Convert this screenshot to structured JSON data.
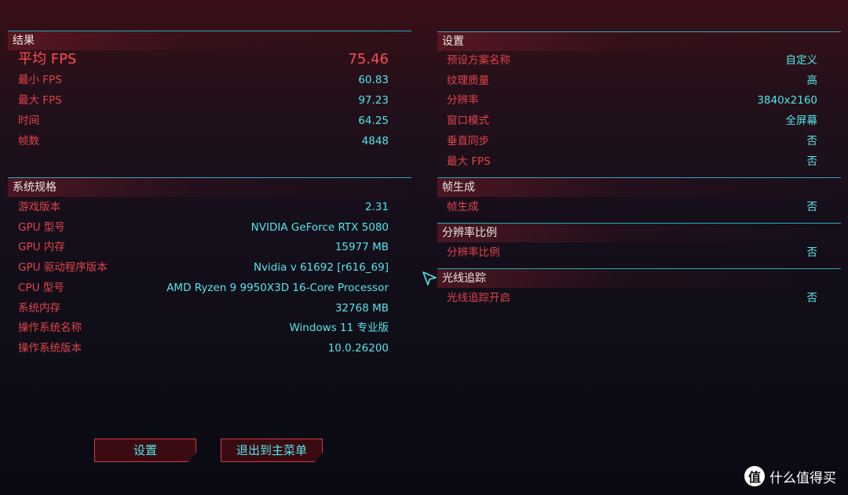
{
  "results": {
    "title": "结果",
    "avg": {
      "label": "平均 FPS",
      "value": "75.46"
    },
    "rows": [
      {
        "label": "最小 FPS",
        "value": "60.83"
      },
      {
        "label": "最大 FPS",
        "value": "97.23"
      },
      {
        "label": "时间",
        "value": "64.25"
      },
      {
        "label": "帧数",
        "value": "4848"
      }
    ]
  },
  "system": {
    "title": "系统规格",
    "rows": [
      {
        "label": "游戏版本",
        "value": "2.31"
      },
      {
        "label": "GPU 型号",
        "value": "NVIDIA GeForce RTX 5080"
      },
      {
        "label": "GPU 内存",
        "value": "15977 MB"
      },
      {
        "label": "GPU 驱动程序版本",
        "value": "Nvidia v 61692 [r616_69]"
      },
      {
        "label": "CPU 型号",
        "value": "AMD Ryzen 9 9950X3D 16-Core Processor"
      },
      {
        "label": "系统内存",
        "value": "32768 MB"
      },
      {
        "label": "操作系统名称",
        "value": "Windows 11 专业版"
      },
      {
        "label": "操作系统版本",
        "value": "10.0.26200"
      }
    ]
  },
  "settings": {
    "title": "设置",
    "rows": [
      {
        "label": "预设方案名称",
        "value": "自定义"
      },
      {
        "label": "纹理质量",
        "value": "高"
      },
      {
        "label": "分辨率",
        "value": "3840x2160"
      },
      {
        "label": "窗口模式",
        "value": "全屏幕"
      },
      {
        "label": "垂直同步",
        "value": "否"
      },
      {
        "label": "最大 FPS",
        "value": "否"
      }
    ]
  },
  "frame_gen": {
    "title": "帧生成",
    "rows": [
      {
        "label": "帧生成",
        "value": "否"
      }
    ]
  },
  "resolution_scale": {
    "title": "分辨率比例",
    "rows": [
      {
        "label": "分辨率比例",
        "value": "否"
      }
    ]
  },
  "ray_tracing": {
    "title": "光线追踪",
    "rows": [
      {
        "label": "光线追踪开启",
        "value": "否"
      }
    ]
  },
  "buttons": {
    "settings": "设置",
    "exit": "退出到主菜单"
  },
  "watermark": {
    "text": "什么值得买",
    "glyph": "值"
  },
  "colors": {
    "label": "#e0434b",
    "value": "#52e6e8",
    "accent": "#2aa8b3",
    "button_border": "#d33a44"
  }
}
